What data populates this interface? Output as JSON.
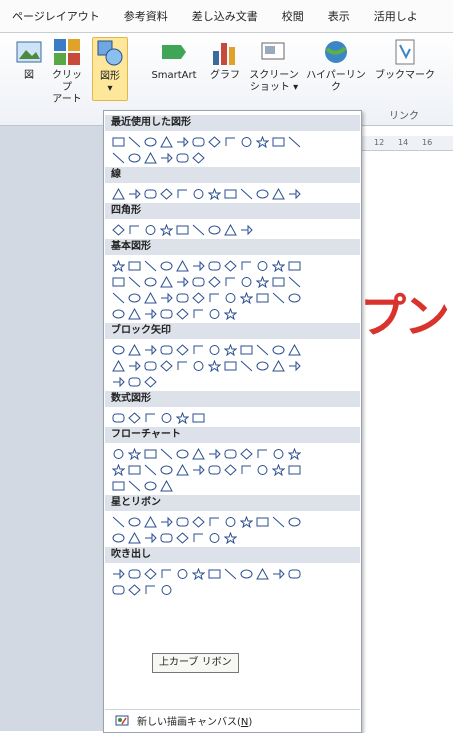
{
  "tabs": [
    "ページレイアウト",
    "参考資料",
    "差し込み文書",
    "校閲",
    "表示",
    "活用しよ"
  ],
  "ribbon": {
    "buttons": [
      {
        "label": "図",
        "icon": "picture-icon"
      },
      {
        "label": "クリップ\nアート",
        "icon": "clipart-icon"
      },
      {
        "label": "図形\n▾",
        "icon": "shapes-icon",
        "selected": true
      },
      {
        "label": "SmartArt",
        "icon": "smartart-icon"
      },
      {
        "label": "グラフ",
        "icon": "chart-icon"
      },
      {
        "label": "スクリーン\nショット ▾",
        "icon": "screenshot-icon"
      },
      {
        "label": "ハイパーリンク",
        "icon": "hyperlink-icon"
      },
      {
        "label": "ブックマーク",
        "icon": "bookmark-icon"
      }
    ],
    "group_link_label": "リンク"
  },
  "ruler_ticks": [
    "12",
    "14",
    "16"
  ],
  "doc_text": "プン",
  "menu": {
    "sections": [
      {
        "title": "最近使用した図形",
        "rows": [
          12,
          6
        ]
      },
      {
        "title": "線",
        "rows": [
          12
        ]
      },
      {
        "title": "四角形",
        "rows": [
          9
        ]
      },
      {
        "title": "基本図形",
        "rows": [
          12,
          12,
          12,
          8
        ]
      },
      {
        "title": "ブロック矢印",
        "rows": [
          12,
          12,
          3
        ]
      },
      {
        "title": "数式図形",
        "rows": [
          6
        ]
      },
      {
        "title": "フローチャート",
        "rows": [
          12,
          12,
          4
        ]
      },
      {
        "title": "星とリボン",
        "rows": [
          12,
          8
        ]
      },
      {
        "title": "吹き出し",
        "rows": [
          12,
          4
        ]
      }
    ],
    "new_canvas_label": "新しい描画キャンバス(",
    "new_canvas_key": "N",
    "new_canvas_suffix": ")"
  },
  "tooltip": "上カーブ リボン",
  "colors": {
    "accent": "#fde79a",
    "section_bg": "#dde2ea",
    "shape_stroke": "#2b4f8f",
    "doc_text": "#d9332e"
  }
}
